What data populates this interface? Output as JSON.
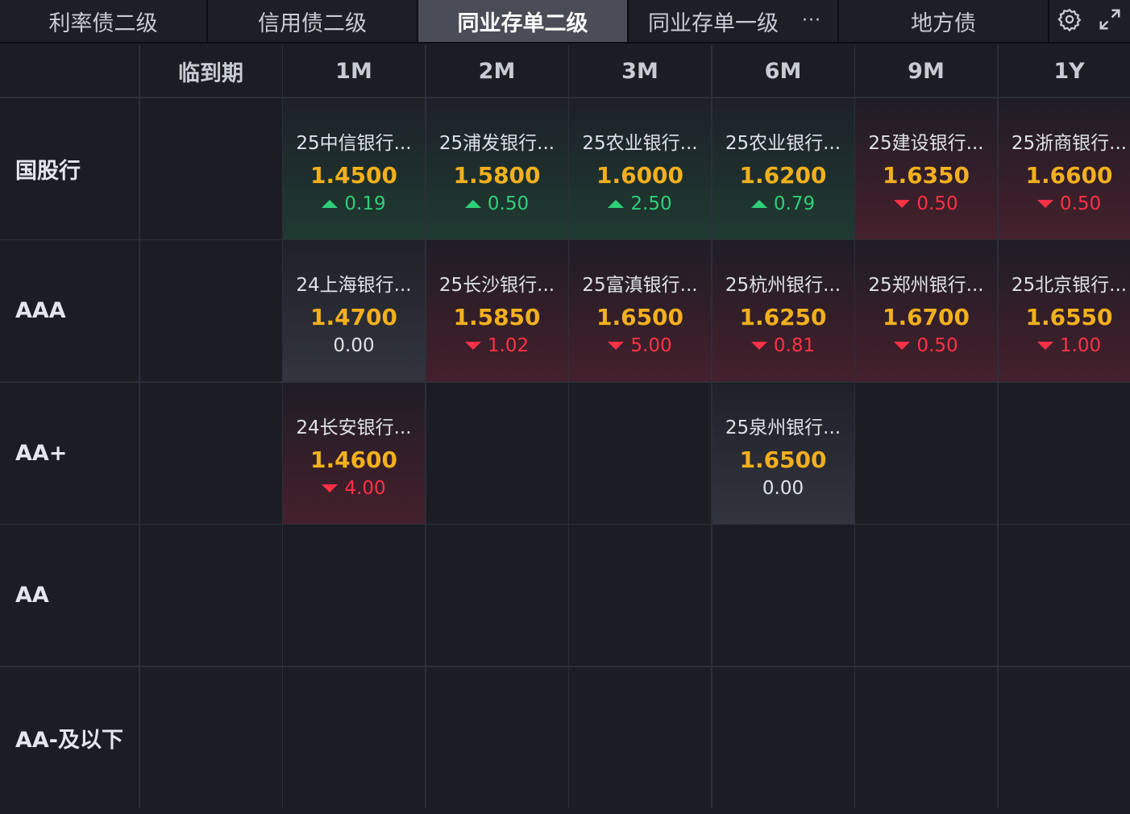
{
  "tabs": [
    {
      "label": "利率债二级",
      "active": false
    },
    {
      "label": "信用债二级",
      "active": false
    },
    {
      "label": "同业存单二级",
      "active": true
    },
    {
      "label": "同业存单一级",
      "active": false,
      "more": "···"
    },
    {
      "label": "地方债",
      "active": false
    }
  ],
  "tools": {
    "settings_icon": "gear-icon",
    "expand_icon": "expand-icon"
  },
  "columns": [
    "临到期",
    "1M",
    "2M",
    "3M",
    "6M",
    "9M",
    "1Y"
  ],
  "rows": [
    {
      "label": "国股行",
      "cells": [
        null,
        {
          "name": "25中信银行...",
          "yield": "1.4500",
          "change": "0.19",
          "dir": "up"
        },
        {
          "name": "25浦发银行...",
          "yield": "1.5800",
          "change": "0.50",
          "dir": "up"
        },
        {
          "name": "25农业银行...",
          "yield": "1.6000",
          "change": "2.50",
          "dir": "up"
        },
        {
          "name": "25农业银行...",
          "yield": "1.6200",
          "change": "0.79",
          "dir": "up"
        },
        {
          "name": "25建设银行...",
          "yield": "1.6350",
          "change": "0.50",
          "dir": "down"
        },
        {
          "name": "25浙商银行...",
          "yield": "1.6600",
          "change": "0.50",
          "dir": "down"
        }
      ]
    },
    {
      "label": "AAA",
      "cells": [
        null,
        {
          "name": "24上海银行...",
          "yield": "1.4700",
          "change": "0.00",
          "dir": "flat"
        },
        {
          "name": "25长沙银行...",
          "yield": "1.5850",
          "change": "1.02",
          "dir": "down"
        },
        {
          "name": "25富滇银行...",
          "yield": "1.6500",
          "change": "5.00",
          "dir": "down"
        },
        {
          "name": "25杭州银行...",
          "yield": "1.6250",
          "change": "0.81",
          "dir": "down"
        },
        {
          "name": "25郑州银行...",
          "yield": "1.6700",
          "change": "0.50",
          "dir": "down"
        },
        {
          "name": "25北京银行...",
          "yield": "1.6550",
          "change": "1.00",
          "dir": "down"
        }
      ]
    },
    {
      "label": "AA+",
      "cells": [
        null,
        {
          "name": "24长安银行...",
          "yield": "1.4600",
          "change": "4.00",
          "dir": "down"
        },
        null,
        null,
        {
          "name": "25泉州银行...",
          "yield": "1.6500",
          "change": "0.00",
          "dir": "flat"
        },
        null,
        null
      ]
    },
    {
      "label": "AA",
      "cells": [
        null,
        null,
        null,
        null,
        null,
        null,
        null
      ]
    },
    {
      "label": "AA-及以下",
      "cells": [
        null,
        null,
        null,
        null,
        null,
        null,
        null
      ]
    }
  ],
  "colors": {
    "up": "#2fcf7a",
    "down": "#ff3146",
    "yield": "#f2b01e"
  }
}
